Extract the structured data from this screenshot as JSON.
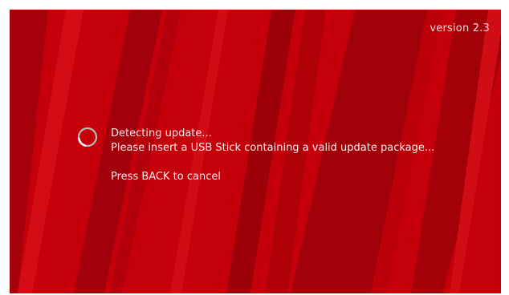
{
  "version_label": "version 2.3",
  "status": {
    "line1": "Detecting update...",
    "line2": "Please insert a USB Stick containing a valid update package...",
    "cancel_hint": "Press BACK to cancel",
    "spinner_icon": "loading-spinner-icon"
  },
  "colors": {
    "background": "#c8000a",
    "stripe_dark": "#a00008",
    "stripe_light": "#d8101a",
    "text": "#fbecec"
  }
}
